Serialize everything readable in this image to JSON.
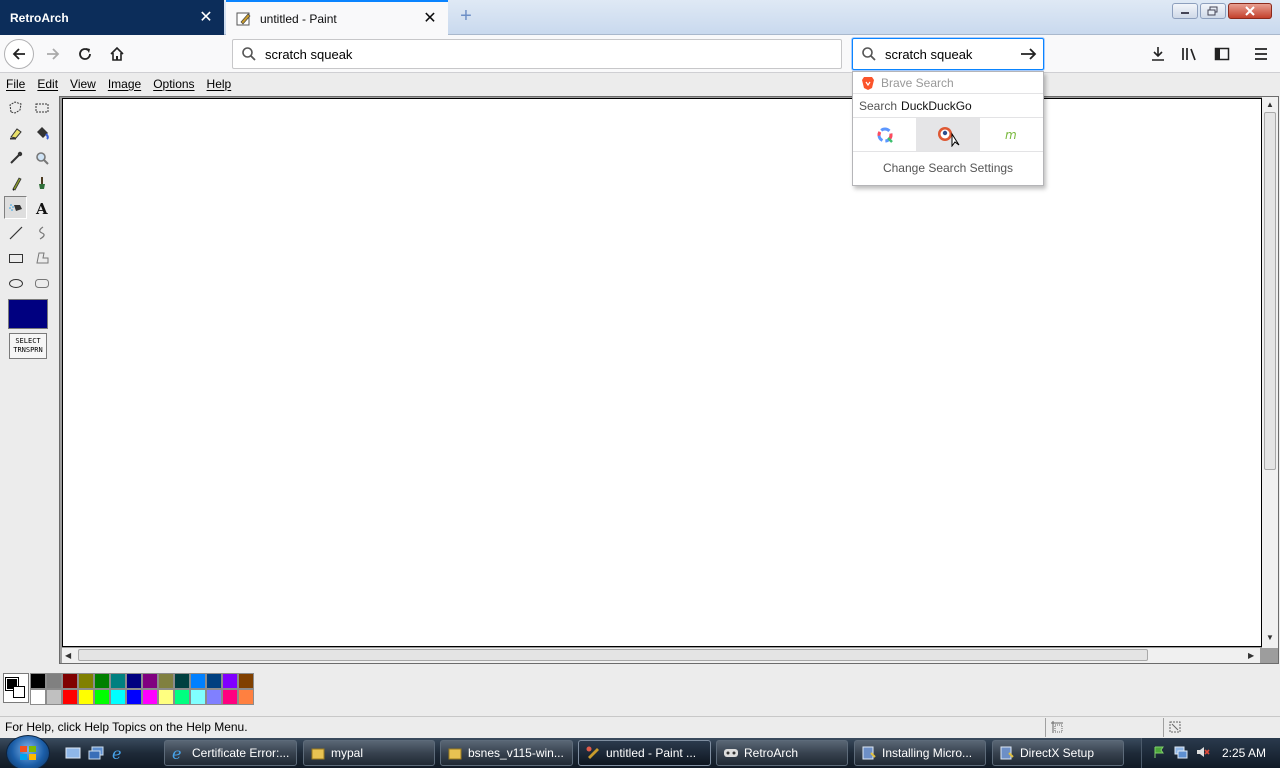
{
  "browser": {
    "tabs": [
      {
        "title": "RetroArch"
      },
      {
        "title": "untitled - Paint"
      }
    ],
    "url": "scratch squeak",
    "search_query": "scratch squeak"
  },
  "search_dropdown": {
    "header_engine": "Brave Search",
    "search_with_prefix": "Search",
    "search_with_engine": "DuckDuckGo",
    "engines": [
      "qwant-icon",
      "duckduckgo-icon",
      "mojeek-icon"
    ],
    "settings_label": "Change Search Settings"
  },
  "paint": {
    "menu": [
      "File",
      "Edit",
      "View",
      "Image",
      "Options",
      "Help"
    ],
    "select_transparent": [
      "SELECT",
      "TRNSPRN"
    ],
    "palette_top": [
      "#000000",
      "#808080",
      "#800000",
      "#808000",
      "#008000",
      "#008080",
      "#000080",
      "#800080",
      "#808040",
      "#004040",
      "#0080ff",
      "#004080",
      "#8000ff",
      "#804000"
    ],
    "palette_bottom": [
      "#ffffff",
      "#c0c0c0",
      "#ff0000",
      "#ffff00",
      "#00ff00",
      "#00ffff",
      "#0000ff",
      "#ff00ff",
      "#ffff80",
      "#00ff80",
      "#80ffff",
      "#8080ff",
      "#ff0080",
      "#ff8040"
    ],
    "foreground": "#000000",
    "background": "#ffffff",
    "status_text": "For Help, click Help Topics on the Help Menu."
  },
  "taskbar": {
    "tasks": [
      {
        "label": "Certificate Error:..."
      },
      {
        "label": "mypal"
      },
      {
        "label": "bsnes_v115-win..."
      },
      {
        "label": "untitled - Paint ..."
      },
      {
        "label": "RetroArch"
      },
      {
        "label": "Installing Micro..."
      },
      {
        "label": "DirectX Setup"
      }
    ],
    "clock": "2:25 AM"
  }
}
